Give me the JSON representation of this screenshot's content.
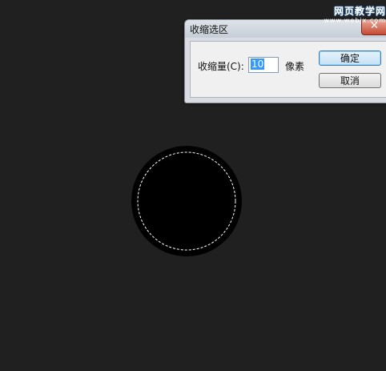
{
  "dialog": {
    "title": "收缩选区",
    "close_glyph": "✕",
    "amount_label": "收缩量(C):",
    "amount_value": "10",
    "unit_label": "像素",
    "ok_label": "确定",
    "cancel_label": "取消"
  },
  "watermark": {
    "site_name": "网页教学网",
    "site_url": "www.webjx.com"
  },
  "colors": {
    "background": "#202020",
    "shape_fill": "#000000",
    "selection_stroke": "#ffffff",
    "close_button": "#c64a33"
  }
}
